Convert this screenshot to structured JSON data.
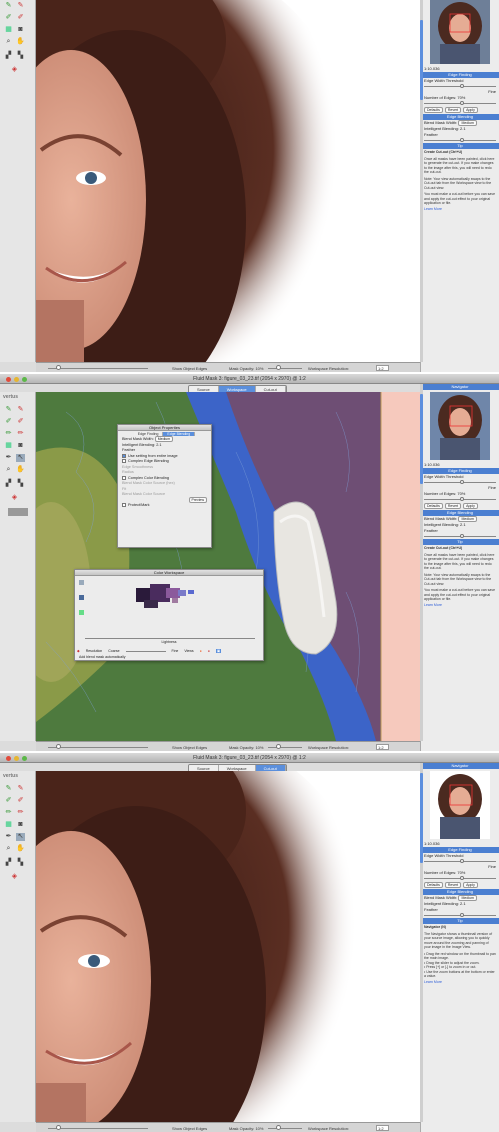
{
  "screens": [
    {
      "window_title": "",
      "tabs": [
        "Source",
        "Workspace",
        "Cut-out"
      ],
      "active_tab": "Cut-out"
    },
    {
      "window_title": "Fluid Mask 3: figure_03_23.tif (2054 x 2970) @ 1:2",
      "tabs": [
        "Source",
        "Workspace",
        "Cut-out"
      ],
      "active_tab": "Workspace"
    },
    {
      "window_title": "Fluid Mask 3: figure_03_23.tif (2054 x 2970) @ 1:2",
      "tabs": [
        "Source",
        "Workspace",
        "Cut-out"
      ],
      "active_tab": "Cut-out"
    }
  ],
  "logo": "vertus",
  "bottom_bar": {
    "show_edges": "Show Object Edges",
    "mask_opacity": "Mask Opacity: 10%",
    "workspace_resolution": "Workspace Resolution:",
    "resolution_value": "1:2"
  },
  "panel": {
    "navigator": "Navigator",
    "zoom": "1:10.036",
    "edge_finding": "Edge Finding",
    "edge_width_threshold": "Edge Width Threshold",
    "fine": "Fine",
    "number_of_edges": "Number of Edges: 70%",
    "fewer": "Fewer",
    "more": "More",
    "buttons": [
      "Defaults",
      "Revert",
      "Apply"
    ],
    "edge_blending": "Edge Blending",
    "blend_mask_width": "Blend Mask Width:",
    "medium": "Medium",
    "intelligent_blending": "Intelligent Blending: 2.1",
    "feather": "Feather",
    "tip": "Tip",
    "tip1": {
      "title": "Create Cut-out (Ctrl+U)",
      "body": "Once all masks have been painted, click here to generate the cut-out. If you make changes to the image after this, you will need to redo the cut-out.",
      "note": "Note: Your view automatically swaps to the Cut-out tab from the Workspace view to the Cut-out view.",
      "body2": "You must make a cut-out before you can save and apply the cut-out effect to your original application or file.",
      "link": "Learn More"
    },
    "tip3": {
      "title": "Navigator (N)",
      "body": "The Navigator shows a thumbnail version of your source image, allowing you to quickly move around the zooming and panning of your image in the Image View.",
      "body2": "• Drag the red window on the thumbnail to pan the main image.\n• Drag the slider to adjust the zoom.\n• Press [+] or [-] to zoom in or out.\n• Use the zoom buttons at the bottom or enter a value.",
      "link": "Learn More"
    }
  },
  "dialog_props": {
    "title": "Object Properties",
    "tabs": [
      "Edge Finding",
      "Edge Blending"
    ],
    "rows": [
      "Blend Mask Width:",
      "Medium",
      "Intelligent Blending: 2.1",
      "Feather",
      "Use setting from entire image",
      "Complex Edge Blending",
      "Edge Smoothness",
      "Radius",
      "Complex Color Blending",
      "Blend Mask Color Source (hex)",
      "Fit",
      "Blend Mask Color Source",
      "Protect/Mark"
    ],
    "button": "Preview"
  },
  "dialog_color": {
    "title": "Color Workspace",
    "footer": "Lightness",
    "row2": "Add blend mask automatically",
    "labels": [
      "Resolution",
      "Coarse",
      "Fine",
      "Views"
    ]
  }
}
